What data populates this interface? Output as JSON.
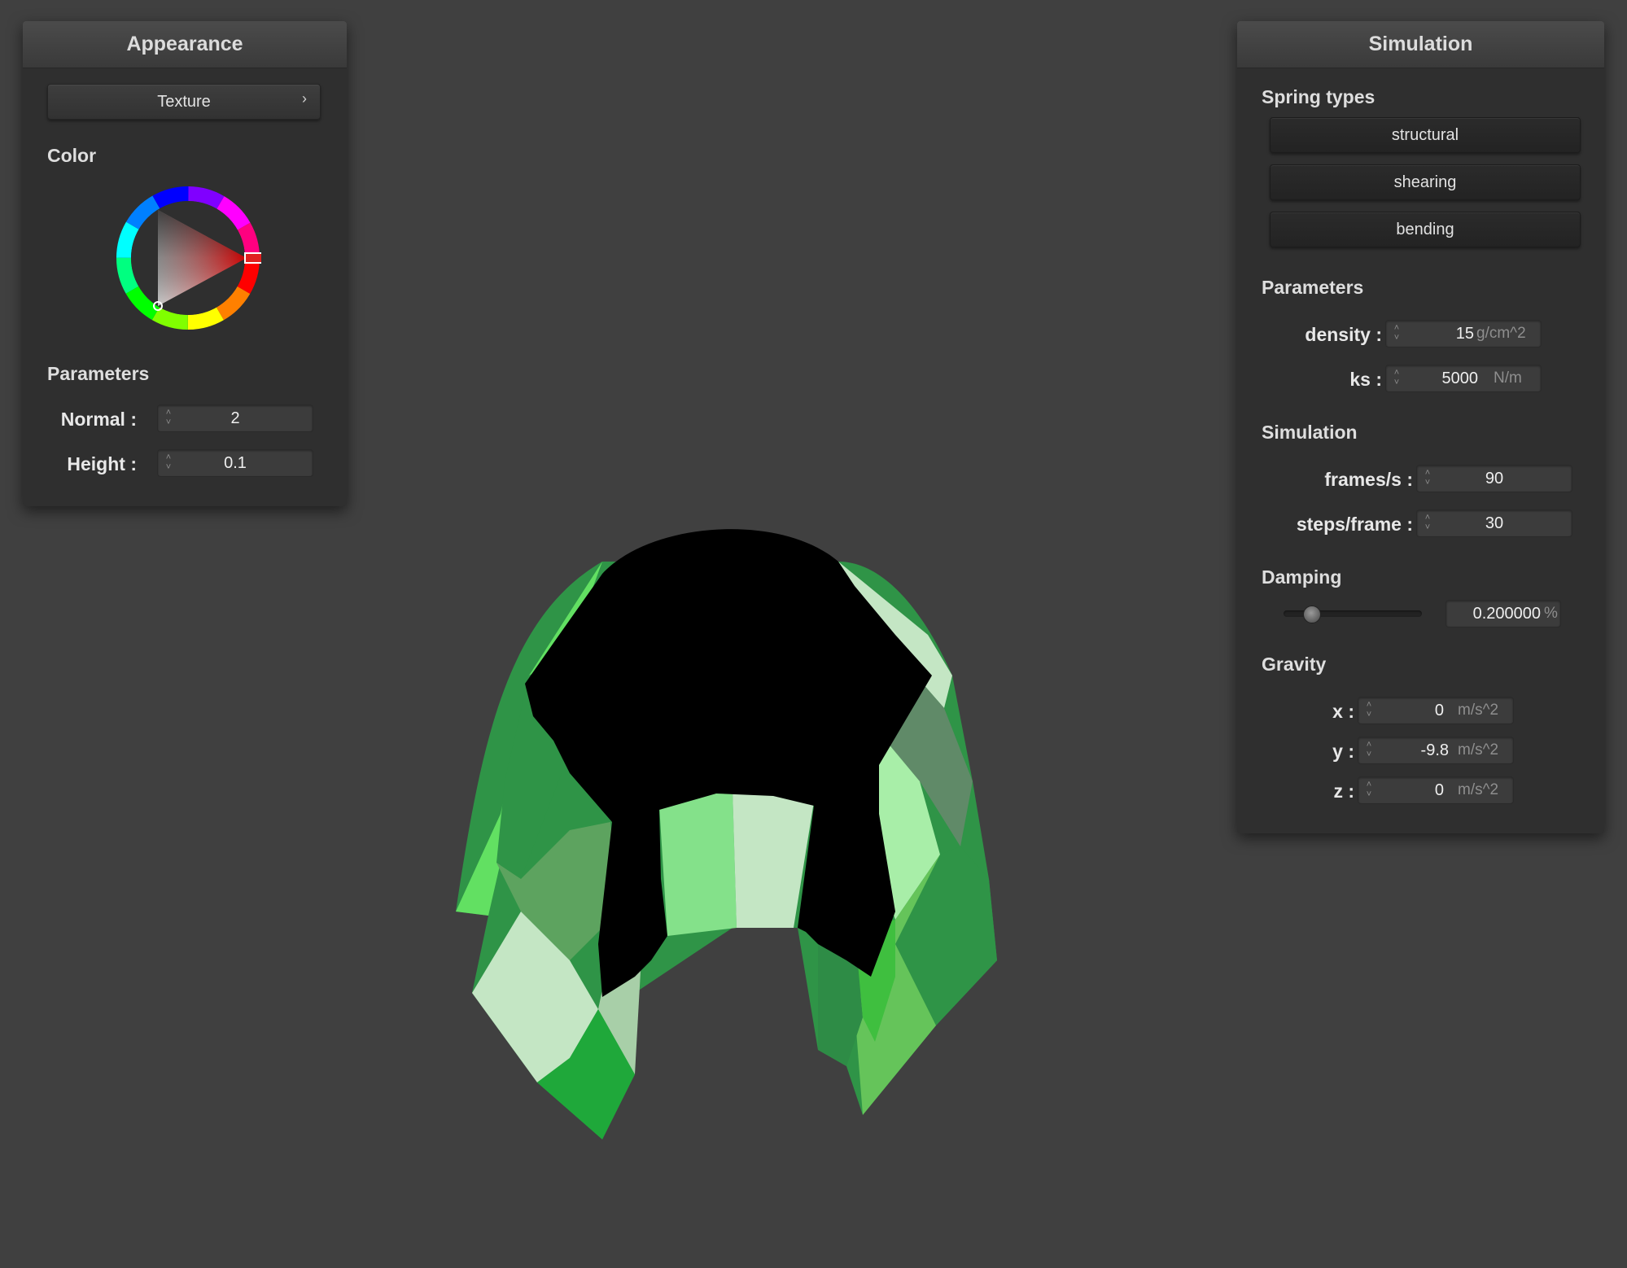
{
  "appearance": {
    "title": "Appearance",
    "texture_button": "Texture",
    "texture_chevron": "›",
    "color_label": "Color",
    "parameters_label": "Parameters",
    "normal_label": "Normal :",
    "normal_value": "2",
    "height_label": "Height :",
    "height_value": "0.1",
    "selected_color": "#ff0000"
  },
  "simulation": {
    "title": "Simulation",
    "spring_types_label": "Spring types",
    "spring_buttons": [
      "structural",
      "shearing",
      "bending"
    ],
    "parameters_label": "Parameters",
    "density_label": "density :",
    "density_value": "15",
    "density_unit": "g/cm^2",
    "ks_label": "ks :",
    "ks_value": "5000",
    "ks_unit": "N/m",
    "simulation_label": "Simulation",
    "fps_label": "frames/s :",
    "fps_value": "90",
    "steps_label": "steps/frame :",
    "steps_value": "30",
    "damping_label": "Damping",
    "damping_value": "0.200000",
    "damping_unit": "%",
    "damping_slider_fraction": 0.2,
    "gravity_label": "Gravity",
    "gx_label": "x :",
    "gx_value": "0",
    "gy_label": "y :",
    "gy_value": "-9.8",
    "gz_label": "z :",
    "gz_value": "0",
    "gravity_unit": "m/s^2"
  },
  "scene": {
    "cloth_colors": [
      "#1fa83a",
      "#2f9447",
      "#5da35f",
      "#62e062",
      "#84e18a",
      "#a8eea8",
      "#c4e6c4",
      "#608a68"
    ],
    "sphere_color": "#000000"
  }
}
